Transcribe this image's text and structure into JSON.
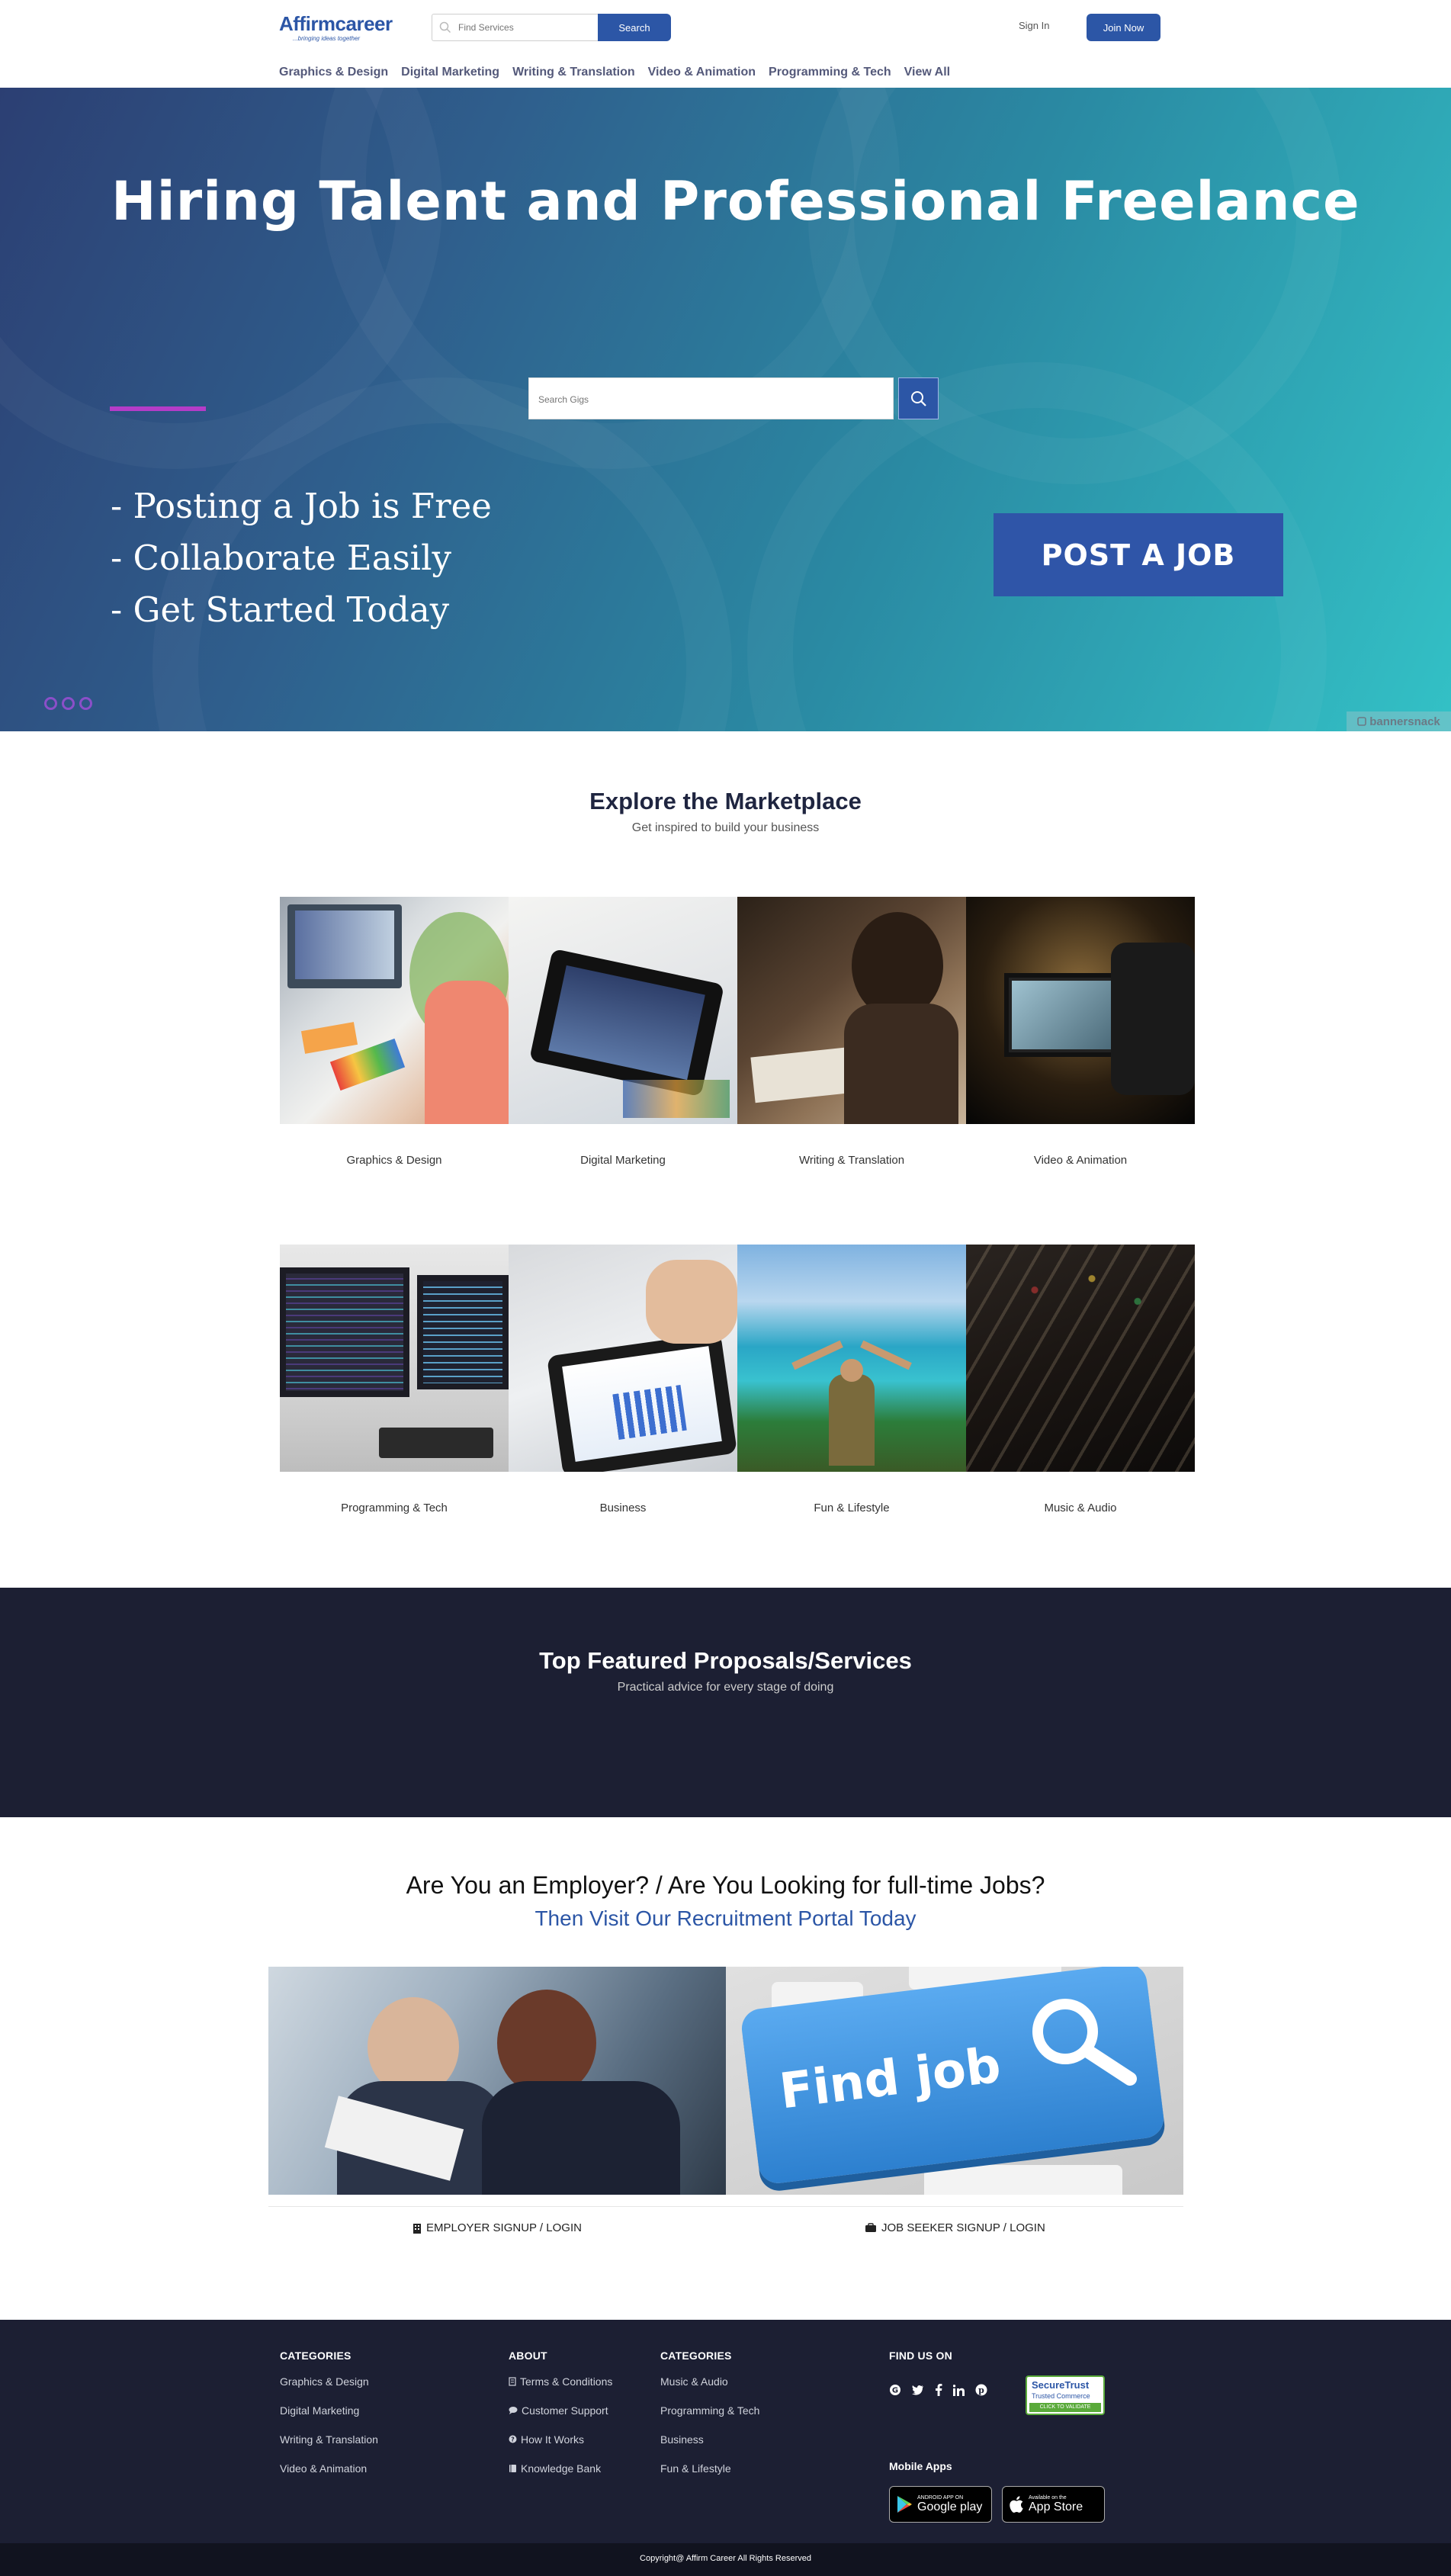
{
  "header": {
    "logo_brand": "Affirmcareer",
    "logo_tagline": "...bringing ideas together",
    "search_placeholder": "Find Services",
    "search_button": "Search",
    "signin": "Sign In",
    "join": "Join Now",
    "nav": [
      "Graphics & Design",
      "Digital Marketing",
      "Writing & Translation",
      "Video & Animation",
      "Programming & Tech",
      "View All"
    ]
  },
  "hero": {
    "title": "Hiring Talent and Professional Freelance",
    "search_placeholder": "Search Gigs",
    "bullets": [
      "- Posting a Job is Free",
      "- Collaborate Easily",
      "- Get Started Today"
    ],
    "cta": "POST A JOB",
    "watermark": "bannersnack",
    "colors": {
      "gradient_start": "#2c3f73",
      "gradient_end": "#33c1c6",
      "rule": "#b53cc8"
    }
  },
  "explore": {
    "title": "Explore the Marketplace",
    "subtitle": "Get inspired to build your business",
    "categories": [
      {
        "label": "Graphics & Design"
      },
      {
        "label": "Digital Marketing"
      },
      {
        "label": "Writing & Translation"
      },
      {
        "label": "Video & Animation"
      },
      {
        "label": "Programming & Tech"
      },
      {
        "label": "Business"
      },
      {
        "label": "Fun & Lifestyle"
      },
      {
        "label": "Music & Audio"
      }
    ]
  },
  "featured": {
    "title": "Top Featured Proposals/Services",
    "subtitle": "Practical advice for every stage of doing"
  },
  "recruit": {
    "question": "Are You an Employer? / Are You Looking for full-time Jobs?",
    "cta": "Then Visit Our Recruitment Portal Today",
    "find_job_text": "Find job",
    "employer_link": "EMPLOYER SIGNUP / LOGIN",
    "seeker_link": "JOB SEEKER SIGNUP / LOGIN"
  },
  "footer": {
    "col1": {
      "title": "CATEGORIES",
      "items": [
        "Graphics & Design",
        "Digital Marketing",
        "Writing & Translation",
        "Video & Animation"
      ]
    },
    "col2": {
      "title": "ABOUT",
      "items": [
        "Terms & Conditions",
        "Customer Support",
        "How It Works",
        "Knowledge Bank"
      ]
    },
    "col3": {
      "title": "CATEGORIES",
      "items": [
        "Music & Audio",
        "Programming & Tech",
        "Business",
        "Fun & Lifestyle"
      ]
    },
    "find_us": "FIND US ON",
    "social_icons": [
      "google-icon",
      "twitter-icon",
      "facebook-icon",
      "linkedin-icon",
      "pinterest-icon"
    ],
    "securetrust": {
      "name": "SecureTrust",
      "line2": "Trusted Commerce",
      "line3": "CLICK TO VALIDATE"
    },
    "mobile_apps": "Mobile Apps",
    "google_play": {
      "small": "ANDROID APP ON",
      "big": "Google play"
    },
    "app_store": {
      "small": "Available on the",
      "big": "App Store"
    },
    "copyright": "Copyright@ Affirm Career All Rights Reserved"
  },
  "colors": {
    "brand_blue": "#2c56a6",
    "dark_navy": "#1c1f33"
  }
}
